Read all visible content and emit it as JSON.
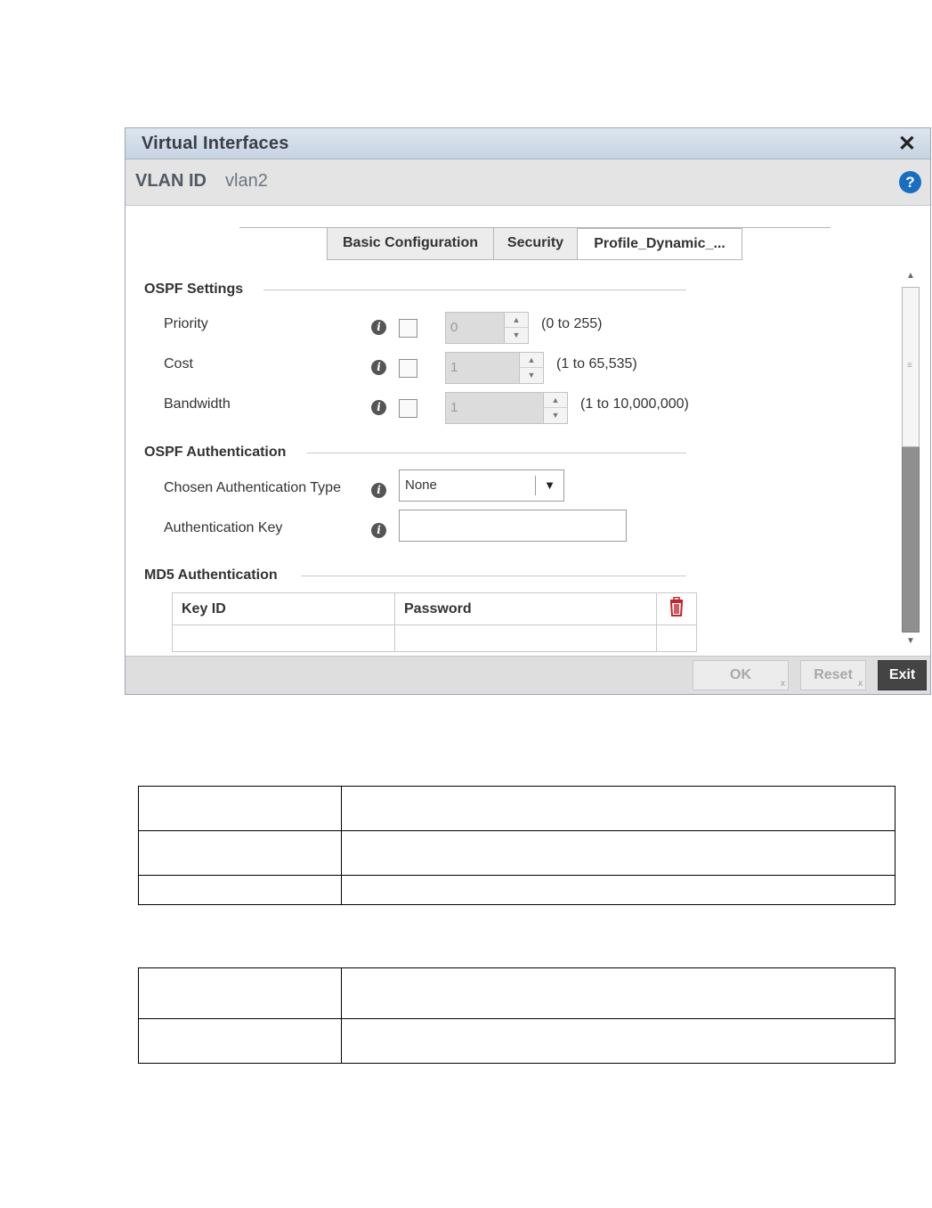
{
  "dialog": {
    "title": "Virtual Interfaces",
    "vlan_label": "VLAN ID",
    "vlan_value": "vlan2",
    "help_glyph": "?",
    "close_glyph": "✕"
  },
  "tabs": [
    {
      "label": "Basic Configuration",
      "active": false
    },
    {
      "label": "Security",
      "active": false
    },
    {
      "label": "Profile_Dynamic_...",
      "active": true
    }
  ],
  "ospf_settings": {
    "heading": "OSPF Settings",
    "rows": [
      {
        "label": "Priority",
        "value": "0",
        "range": "(0 to 255)"
      },
      {
        "label": "Cost",
        "value": "1",
        "range": "(1 to 65,535)"
      },
      {
        "label": "Bandwidth",
        "value": "1",
        "range": "(1 to 10,000,000)"
      }
    ]
  },
  "ospf_auth": {
    "heading": "OSPF Authentication",
    "type_label": "Chosen Authentication Type",
    "type_value": "None",
    "key_label": "Authentication Key",
    "key_value": ""
  },
  "md5": {
    "heading": "MD5 Authentication",
    "columns": [
      "Key ID",
      "Password"
    ]
  },
  "footer": {
    "ok": "OK",
    "reset": "Reset",
    "exit": "Exit",
    "small_x": "x"
  },
  "icons": {
    "info": "info-icon",
    "trash": "trash-icon",
    "dropdown": "▼",
    "spin_up": "▲",
    "spin_down": "▼"
  },
  "colors": {
    "help": "#1a6ec2",
    "trash": "#c0262d",
    "exit_button": "#444444"
  }
}
